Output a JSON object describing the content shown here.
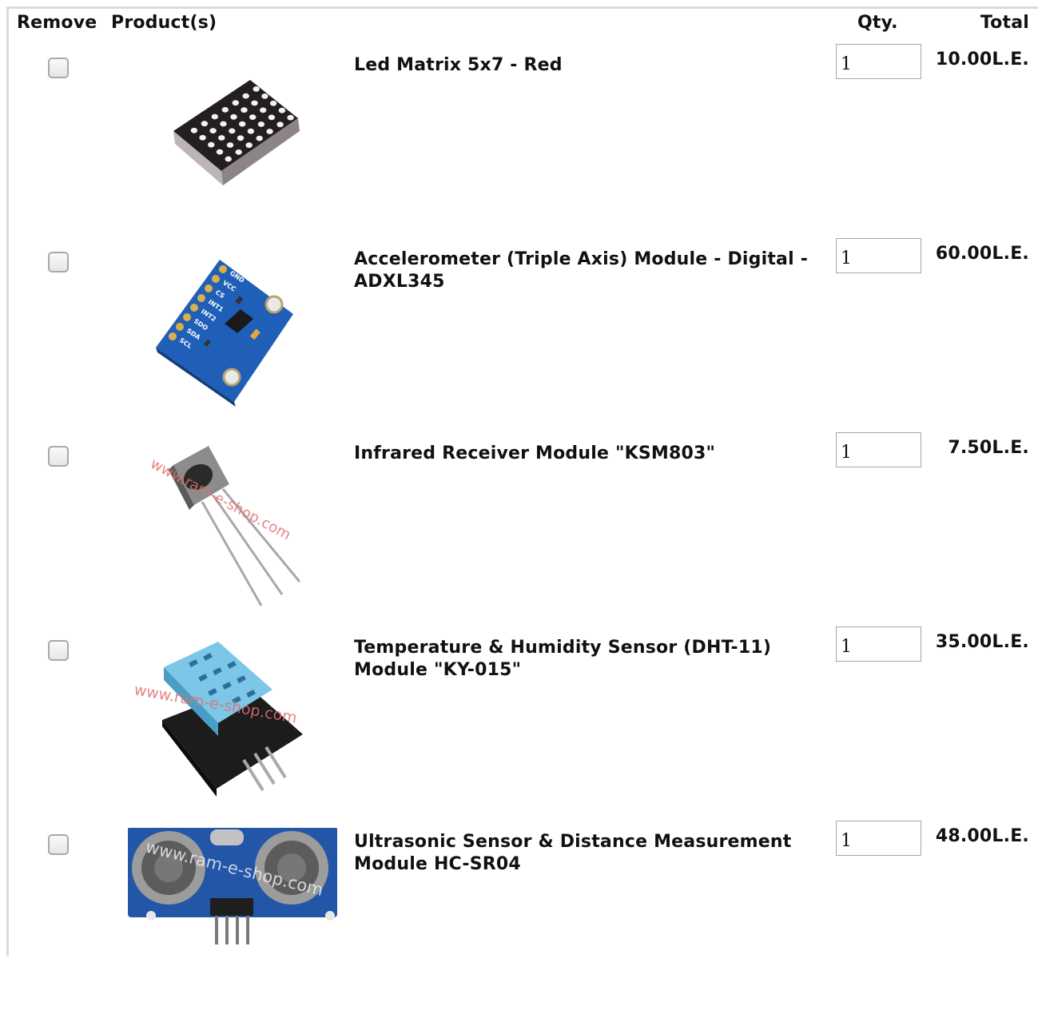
{
  "headers": {
    "remove": "Remove",
    "products": "Product(s)",
    "qty": "Qty.",
    "total": "Total"
  },
  "items": [
    {
      "name": "Led Matrix 5x7 - Red",
      "qty": "1",
      "total": "10.00L.E.",
      "image_icon": "led-matrix-image"
    },
    {
      "name": "Accelerometer (Triple Axis) Module - Digital - ADXL345",
      "qty": "1",
      "total": "60.00L.E.",
      "image_icon": "accelerometer-image"
    },
    {
      "name": "Infrared Receiver Module \"KSM803\"",
      "qty": "1",
      "total": "7.50L.E.",
      "image_icon": "ir-receiver-image"
    },
    {
      "name": "Temperature & Humidity Sensor (DHT-11) Module \"KY-015\"",
      "qty": "1",
      "total": "35.00L.E.",
      "image_icon": "dht11-image"
    },
    {
      "name": "Ultrasonic Sensor & Distance Measurement Module HC-SR04",
      "qty": "1",
      "total": "48.00L.E.",
      "image_icon": "ultrasonic-image"
    }
  ],
  "image_text": {
    "watermark": "www.ram-e-shop.com",
    "accel_pins": [
      "GND",
      "VCC",
      "CS",
      "INT1",
      "INT2",
      "SDO",
      "SDA",
      "SCL"
    ]
  }
}
